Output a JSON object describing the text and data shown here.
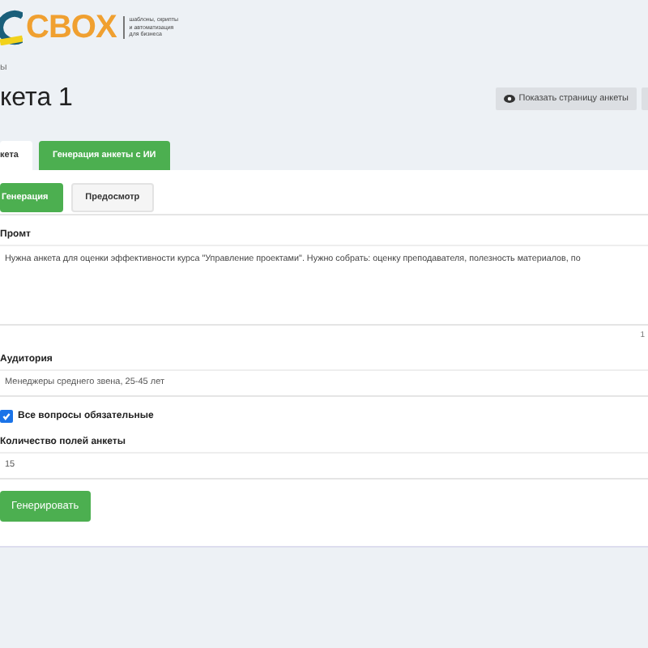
{
  "logo": {
    "name": "CBOX",
    "tagline": [
      "шаблоны, скрипты",
      "и автоматизация",
      "для бизнеса"
    ]
  },
  "breadcrumb": "ы",
  "title": "кета 1",
  "header_buttons": [
    {
      "label": "Показать страницу анкеты",
      "kind": "view"
    },
    {
      "kind": "cut"
    }
  ],
  "tabs": [
    {
      "label": "кета",
      "selected": false
    },
    {
      "label": "Генерация анкеты с ИИ",
      "selected": true
    }
  ],
  "subtabs": [
    {
      "label": "Генерация",
      "selected": true
    },
    {
      "label": "Предосмотр",
      "selected": false
    }
  ],
  "prompt": {
    "label": "Промт",
    "value": "Нужна анкета для оценки эффективности курса \"Управление проектами\". Нужно собрать: оценку преподавателя, полезность материалов, по",
    "counter": "1"
  },
  "audience": {
    "label": "Аудитория",
    "value": "Менеджеры среднего звена, 25-45 лет"
  },
  "required": {
    "label": "Все вопросы обязательные",
    "checked": true
  },
  "fields_count": {
    "label": "Количество полей анкеты",
    "value": "15"
  },
  "submit": "Генерировать"
}
